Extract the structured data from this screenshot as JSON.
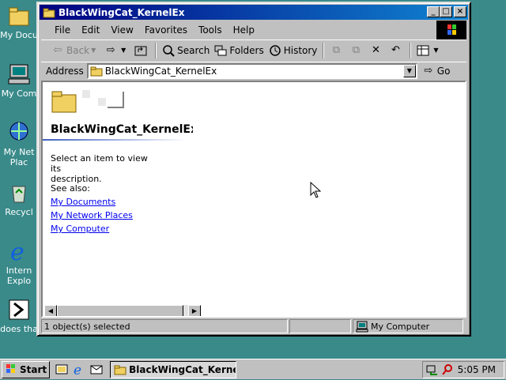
{
  "desktop": {
    "icons": [
      {
        "label": "My Docu",
        "icon": "folder-icon"
      },
      {
        "label": "My Com",
        "icon": "computer-icon"
      },
      {
        "label1": "My Net",
        "label2": "Plac",
        "icon": "network-icon"
      },
      {
        "label": "Recycl",
        "icon": "recycle-bin-icon"
      },
      {
        "label1": "Intern",
        "label2": "Explo",
        "icon": "ie-icon"
      },
      {
        "label": "does tha",
        "icon": "shortcut-icon"
      }
    ]
  },
  "window": {
    "title": "BlackWingCat_KernelEx",
    "controls": {
      "minimize": "_",
      "maximize": "□",
      "close": "×"
    }
  },
  "menu": [
    "File",
    "Edit",
    "View",
    "Favorites",
    "Tools",
    "Help"
  ],
  "toolbar": {
    "back": "Back",
    "search": "Search",
    "folders": "Folders",
    "history": "History"
  },
  "address": {
    "label": "Address",
    "value": "BlackWingCat_KernelEx",
    "go": "Go"
  },
  "content": {
    "heading": "BlackWingCat_KernelEx",
    "description_line1": "Select an item to view its",
    "description_line2": "description.",
    "see_also": "See also:",
    "links": [
      "My Documents",
      "My Network Places",
      "My Computer"
    ]
  },
  "status": {
    "selected": "1 object(s) selected",
    "zone": "My Computer"
  },
  "taskbar": {
    "start": "Start",
    "task": "BlackWingCat_Kernel...",
    "time": "5:05 PM"
  },
  "colors": {
    "desktop": "#3a8a8a",
    "title_start": "#000080",
    "title_end": "#1084d0",
    "link": "#0000ee"
  }
}
